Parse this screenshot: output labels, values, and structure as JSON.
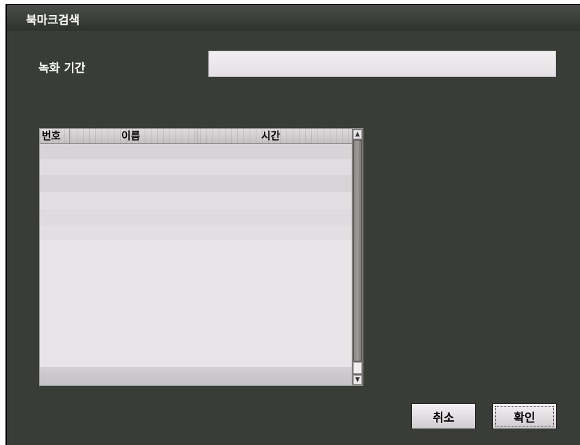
{
  "dialog": {
    "title": "북마크검색",
    "recording_period_label": "녹화 기간",
    "recording_period_value": "",
    "list": {
      "columns": [
        "번호",
        "이름",
        "시간"
      ],
      "rows": []
    },
    "buttons": {
      "cancel": "취소",
      "ok": "확인"
    }
  },
  "icons": {
    "scroll_up": "scroll-up-arrow-icon",
    "scroll_down": "scroll-down-arrow-icon"
  },
  "colors": {
    "window_bg": "#3a3c38",
    "list_bg": "#e6e2e6",
    "text_light": "#ffffff"
  }
}
